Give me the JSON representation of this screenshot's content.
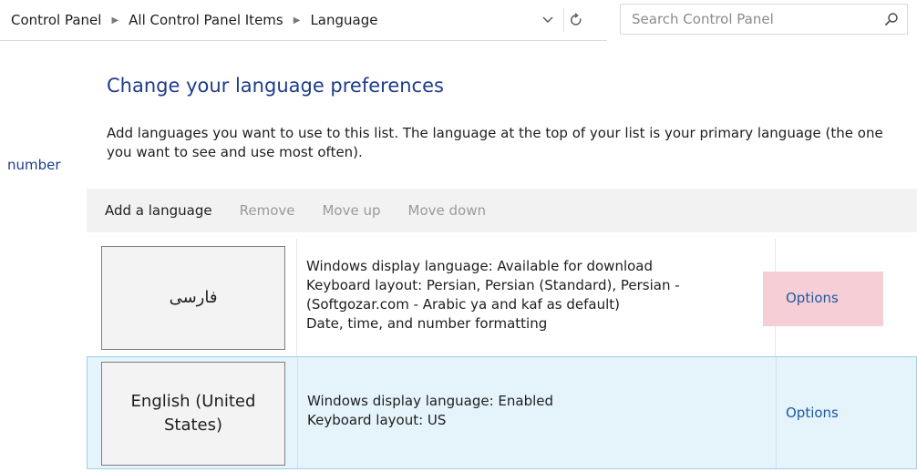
{
  "address_bar": {
    "breadcrumbs": [
      "Control Panel",
      "All Control Panel Items",
      "Language"
    ],
    "separator_icon": "chevron-right-icon",
    "dropdown_icon": "chevron-down-icon",
    "refresh_icon": "refresh-icon"
  },
  "search": {
    "placeholder": "Search Control Panel",
    "value": "",
    "icon": "search-icon"
  },
  "page": {
    "title": "Change your language preferences",
    "description": "Add languages you want to use to this list. The language at the top of your list is your primary language (the one you want to see and use most often).",
    "side_link": "number"
  },
  "toolbar": {
    "add_label": "Add a language",
    "remove_label": "Remove",
    "move_up_label": "Move up",
    "move_down_label": "Move down"
  },
  "languages": [
    {
      "name": "فارسی",
      "details": [
        "Windows display language: Available for download",
        "Keyboard layout: Persian, Persian (Standard), Persian -",
        "(Softgozar.com - Arabic ya and kaf as default)",
        "Date, time, and number formatting"
      ],
      "options_label": "Options",
      "selected": false
    },
    {
      "name": "English (United States)",
      "details": [
        "Windows display language: Enabled",
        "Keyboard layout: US"
      ],
      "options_label": "Options",
      "selected": true
    }
  ],
  "colors": {
    "title": "#1e3c8a",
    "link": "#1e5aa0",
    "selected_row_bg": "#e5f3fb",
    "selected_row_border": "#9fd0ea",
    "options_highlight": "#f6cfd6",
    "toolbar_bg": "#f2f2f2",
    "disabled_text": "#9a9a9a"
  }
}
